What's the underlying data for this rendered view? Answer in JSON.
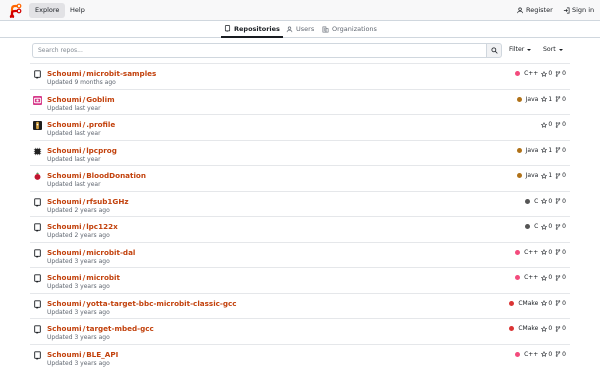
{
  "nav": {
    "explore": "Explore",
    "help": "Help",
    "register": "Register",
    "signin": "Sign in"
  },
  "tabs": [
    {
      "label": "Repositories",
      "active": true,
      "icon": "repo-icon"
    },
    {
      "label": "Users",
      "active": false,
      "icon": "person-icon"
    },
    {
      "label": "Organizations",
      "active": false,
      "icon": "organization-icon"
    }
  ],
  "search": {
    "placeholder": "Search repos...",
    "value": ""
  },
  "filters": {
    "filter_label": "Filter",
    "sort_label": "Sort"
  },
  "colors": {
    "link": "#c2410c",
    "cpp": "#f34b7d",
    "java": "#b07219",
    "c": "#555555",
    "cmake": "#da3434"
  },
  "repos": [
    {
      "owner": "Schoumi",
      "name": "microbit-samples",
      "updated": "Updated 9 months ago",
      "language": "C++",
      "lang_color": "#f34b7d",
      "stars": "0",
      "forks": "0",
      "icon": "repo-icon"
    },
    {
      "owner": "Schoumi",
      "name": "Goblim",
      "updated": "Updated last year",
      "language": "Java",
      "lang_color": "#b07219",
      "stars": "1",
      "forks": "0",
      "icon": "goblim-avatar"
    },
    {
      "owner": "Schoumi",
      "name": ".profile",
      "updated": "Updated last year",
      "language": "",
      "lang_color": "",
      "stars": "0",
      "forks": "0",
      "icon": "profile-avatar"
    },
    {
      "owner": "Schoumi",
      "name": "lpcprog",
      "updated": "Updated last year",
      "language": "Java",
      "lang_color": "#b07219",
      "stars": "1",
      "forks": "0",
      "icon": "chip-avatar"
    },
    {
      "owner": "Schoumi",
      "name": "BloodDonation",
      "updated": "Updated last year",
      "language": "Java",
      "lang_color": "#b07219",
      "stars": "1",
      "forks": "0",
      "icon": "blood-drop-avatar"
    },
    {
      "owner": "Schoumi",
      "name": "rfsub1GHz",
      "updated": "Updated 2 years ago",
      "language": "C",
      "lang_color": "#555555",
      "stars": "0",
      "forks": "0",
      "icon": "repo-icon"
    },
    {
      "owner": "Schoumi",
      "name": "lpc122x",
      "updated": "Updated 2 years ago",
      "language": "C",
      "lang_color": "#555555",
      "stars": "0",
      "forks": "0",
      "icon": "repo-icon"
    },
    {
      "owner": "Schoumi",
      "name": "microbit-dal",
      "updated": "Updated 3 years ago",
      "language": "C++",
      "lang_color": "#f34b7d",
      "stars": "0",
      "forks": "0",
      "icon": "repo-icon"
    },
    {
      "owner": "Schoumi",
      "name": "microbit",
      "updated": "Updated 3 years ago",
      "language": "C++",
      "lang_color": "#f34b7d",
      "stars": "0",
      "forks": "0",
      "icon": "repo-icon"
    },
    {
      "owner": "Schoumi",
      "name": "yotta-target-bbc-microbit-classic-gcc",
      "updated": "Updated 3 years ago",
      "language": "CMake",
      "lang_color": "#da3434",
      "stars": "0",
      "forks": "0",
      "icon": "repo-icon"
    },
    {
      "owner": "Schoumi",
      "name": "target-mbed-gcc",
      "updated": "Updated 3 years ago",
      "language": "CMake",
      "lang_color": "#da3434",
      "stars": "0",
      "forks": "0",
      "icon": "repo-icon"
    },
    {
      "owner": "Schoumi",
      "name": "BLE_API",
      "updated": "Updated 3 years ago",
      "language": "C++",
      "lang_color": "#f34b7d",
      "stars": "0",
      "forks": "0",
      "icon": "repo-icon"
    }
  ]
}
